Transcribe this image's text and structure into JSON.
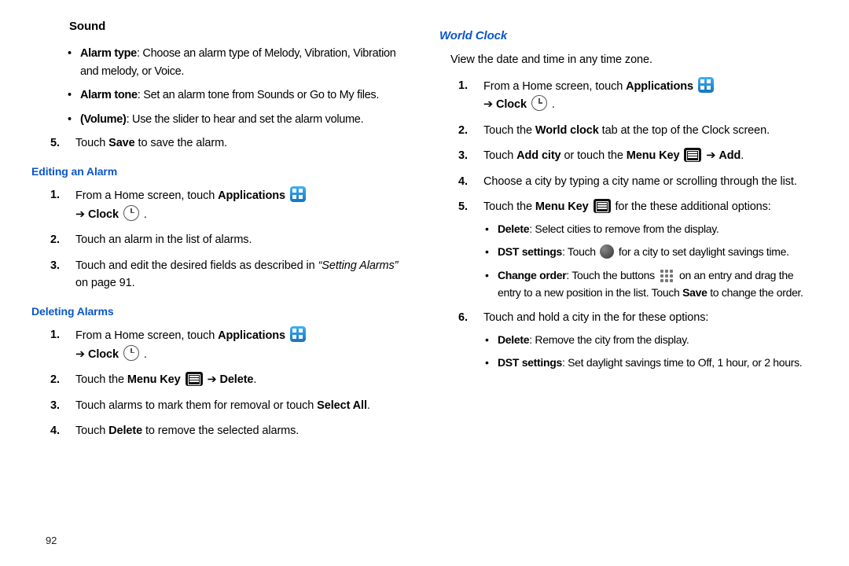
{
  "left": {
    "sound_title": "Sound",
    "bullets": [
      {
        "label": "Alarm type",
        "text": ": Choose an alarm type of Melody, Vibration, Vibration and melody, or Voice."
      },
      {
        "label": "Alarm tone",
        "text": ": Set an alarm tone from Sounds or Go to My files."
      },
      {
        "label": "(Volume)",
        "text": ": Use the slider to hear and set the alarm volume."
      }
    ],
    "step5": {
      "num": "5.",
      "pre": "Touch ",
      "bold": "Save",
      "post": " to save the alarm."
    },
    "editing_title": "Editing an Alarm",
    "edit1": {
      "num": "1.",
      "pre": "From a Home screen, touch ",
      "apps": "Applications",
      "arrow": "➔",
      "clock": "Clock",
      "dot": " ."
    },
    "edit2": {
      "num": "2.",
      "text": "Touch an alarm in the list of alarms."
    },
    "edit3": {
      "num": "3.",
      "pre": "Touch and edit the desired fields as described in ",
      "ital": "“Setting Alarms”",
      "post": " on page 91."
    },
    "deleting_title": "Deleting Alarms",
    "del1": {
      "num": "1.",
      "pre": "From a Home screen, touch ",
      "apps": "Applications",
      "arrow": "➔",
      "clock": "Clock",
      "dot": " ."
    },
    "del2": {
      "num": "2.",
      "pre": "Touch the ",
      "menu": "Menu Key",
      "arrow": " ➔ ",
      "delete": "Delete",
      "dot": "."
    },
    "del3": {
      "num": "3.",
      "pre": "Touch alarms to mark them for removal or touch ",
      "bold": "Select All",
      "dot": "."
    },
    "del4": {
      "num": "4.",
      "pre": "Touch ",
      "bold": "Delete",
      "post": " to remove the selected alarms."
    }
  },
  "right": {
    "title": "World Clock",
    "intro": "View the date and time in any time zone.",
    "s1": {
      "num": "1.",
      "pre": "From a Home screen, touch ",
      "apps": "Applications",
      "arrow": "➔",
      "clock": "Clock",
      "dot": " ."
    },
    "s2": {
      "num": "2.",
      "pre": "Touch the ",
      "bold": "World clock",
      "post": " tab at the top of the Clock screen."
    },
    "s3": {
      "num": "3.",
      "pre": "Touch ",
      "b1": "Add city",
      "mid": " or touch the ",
      "b2": "Menu Key",
      "arrow": " ➔ ",
      "b3": "Add",
      "dot": "."
    },
    "s4": {
      "num": "4.",
      "text": "Choose a city by typing a city name or scrolling through the list."
    },
    "s5": {
      "num": "5.",
      "pre": "Touch the ",
      "menu": "Menu Key",
      "post": " for the these additional options:"
    },
    "s5b": [
      {
        "label": "Delete",
        "text": ": Select cities to remove from the display."
      },
      {
        "label": "DST settings",
        "text_pre": ": Touch ",
        "text_post": " for a city to set daylight savings time."
      },
      {
        "label": "Change order",
        "text_pre": ": Touch the buttons ",
        "text_mid": " on an entry and drag the entry to a new position in the list. Touch ",
        "save": "Save",
        "text_post": " to change the order."
      }
    ],
    "s6": {
      "num": "6.",
      "text": "Touch and hold a city in the for these options:"
    },
    "s6b": [
      {
        "label": "Delete",
        "text": ": Remove the city from the display."
      },
      {
        "label": "DST settings",
        "text": ": Set daylight savings time to Off, 1 hour, or 2 hours."
      }
    ]
  },
  "page": "92"
}
